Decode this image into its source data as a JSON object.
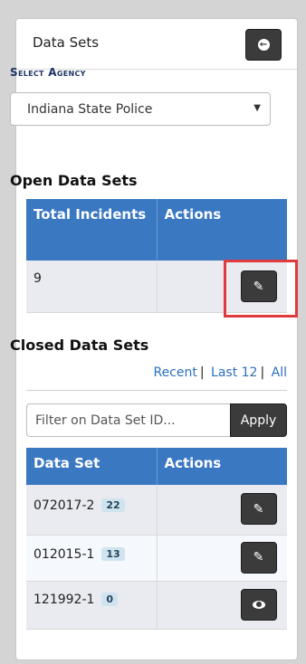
{
  "panel": {
    "title": "Data Sets",
    "collapse_icon": "circle-arrow-left-icon"
  },
  "agency": {
    "label": "Select Agency",
    "selected": "Indiana State Police"
  },
  "open_sets": {
    "title": "Open Data Sets",
    "headers": [
      "Total Incidents",
      "Actions"
    ],
    "rows": [
      {
        "total": "9",
        "action_icon": "edit-icon"
      }
    ]
  },
  "closed_sets": {
    "title": "Closed Data Sets",
    "links": [
      "Recent",
      "Last 12",
      "All"
    ],
    "filter_placeholder": "Filter on Data Set ID...",
    "apply_label": "Apply",
    "headers": [
      "Data Set",
      "Actions"
    ],
    "rows": [
      {
        "id": "072017-2",
        "count": "22",
        "action_icon": "edit-icon"
      },
      {
        "id": "012015-1",
        "count": "13",
        "action_icon": "edit-icon"
      },
      {
        "id": "121992-1",
        "count": "0",
        "action_icon": "eye-icon"
      }
    ]
  },
  "colors": {
    "header_blue": "#3a78c2",
    "dark_button": "#3b3b3b",
    "highlight_red": "#e0393e",
    "link_blue": "#2c6fbf"
  }
}
